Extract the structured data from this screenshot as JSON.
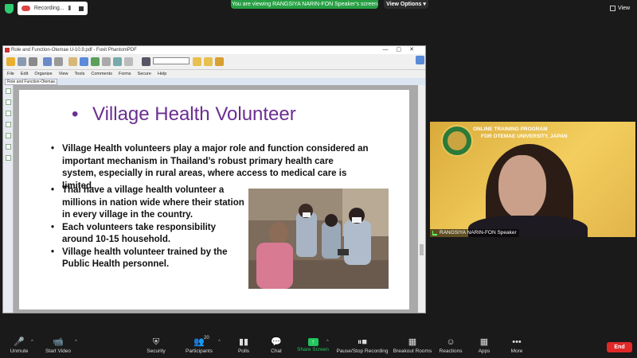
{
  "top_bar": {
    "recording_label": "Recording...",
    "pause_glyph": "II",
    "viewing_banner": "You are viewing RANGSIYA NARIN-FON Speaker's screen",
    "view_options_label": "View Options",
    "view_options_caret": "▾",
    "view_label": "View"
  },
  "shared_window": {
    "title": "Role and Function-Otemae U-10.9.pdf - Foxit PhantomPDF",
    "window_controls": "—▢✕",
    "menu": [
      "File",
      "Edit",
      "Organize",
      "View",
      "Tools",
      "Comments",
      "Forms",
      "Secure",
      "Help"
    ],
    "tab_label": "Role and Function-Otemae..."
  },
  "slide": {
    "title_bullet": "•",
    "title": "Village Health Volunteer",
    "bullets_top": [
      "Village Health volunteers play a major role and function considered an important mechanism  in Thailand’s robust  primary health care system, especially in rural areas, where access to medical care is limited."
    ],
    "bullets_bottom": [
      "Thai have a village health volunteer a millions in nation wide where their station in every village in the country.",
      "Each volunteers take responsibility around 10-15 household.",
      "Village health volunteer trained by the Public Health personnel."
    ],
    "title_color": "#6b2e91"
  },
  "speaker": {
    "banner_line1": "ONLINE TRAINING PROGRAM",
    "banner_line2": "FOR OTEMAE UNIVERSITY, JAPAN",
    "name_label": "RANGSIYA NARIN-FON Speaker"
  },
  "controls": {
    "unmute": "Unmute",
    "start_video": "Start Video",
    "security": "Security",
    "participants": "Participants",
    "participants_count": "20",
    "polls": "Polls",
    "chat": "Chat",
    "share_screen": "Share Screen",
    "pause_recording": "Pause/Stop Recording",
    "breakout_rooms": "Breakout Rooms",
    "reactions": "Reactions",
    "apps": "Apps",
    "more": "More",
    "end": "End",
    "caret": "^",
    "share_arrow": "↑",
    "icons": {
      "unmute": "🎤",
      "start_video": "📹",
      "security": "⛨",
      "participants": "👥",
      "polls": "▮▮",
      "chat": "💬",
      "pause_recording": "⏸■",
      "breakout_rooms": "▦",
      "reactions": "☺",
      "apps": "▦",
      "more": "•••"
    },
    "accent_green": "#22c55e",
    "end_red": "#e02828"
  }
}
